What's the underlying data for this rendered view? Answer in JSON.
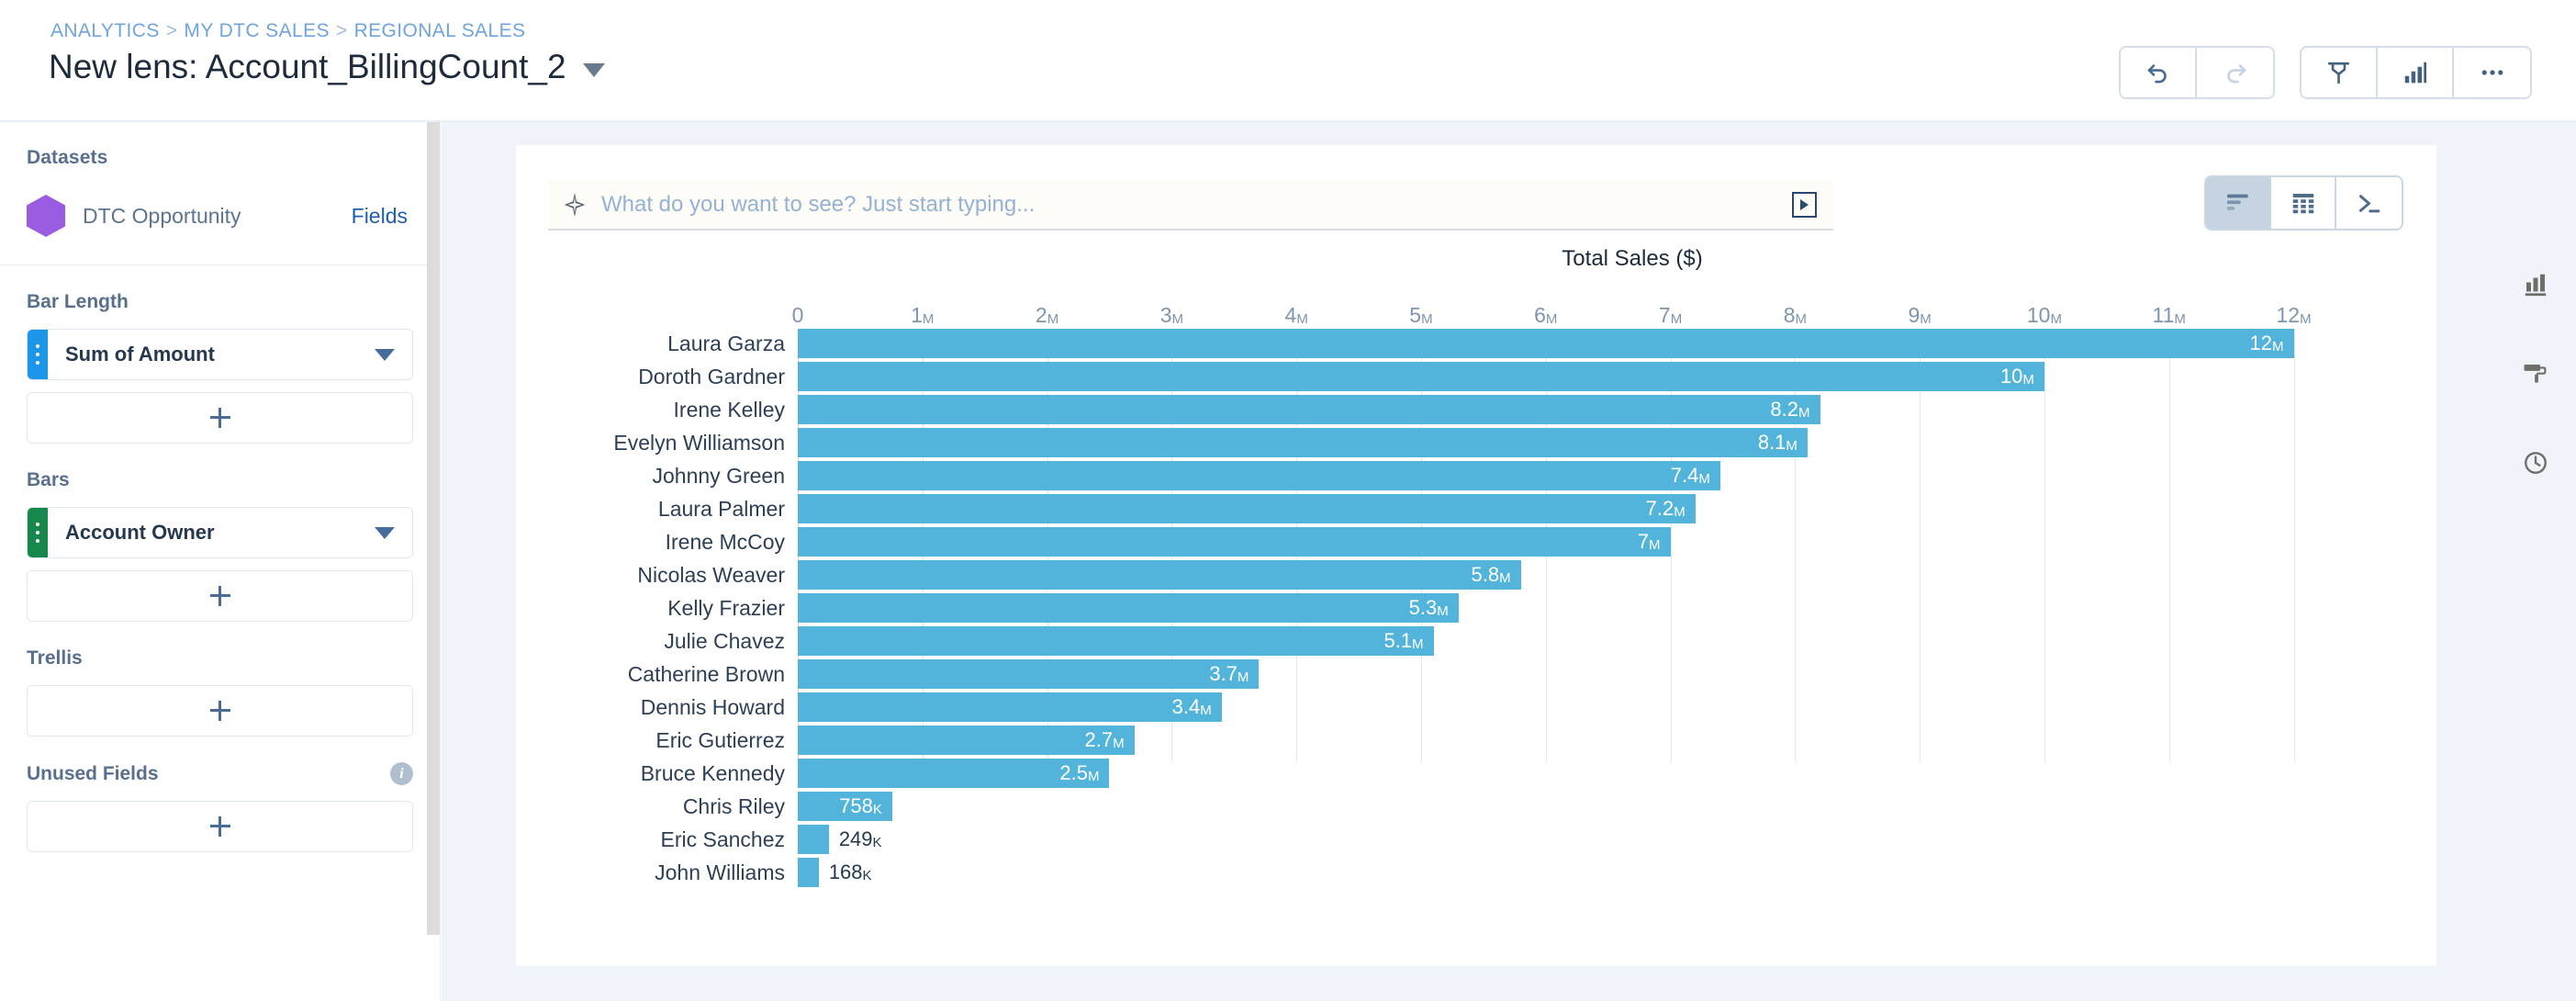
{
  "header": {
    "breadcrumb": [
      "ANALYTICS",
      "MY DTC SALES",
      "REGIONAL SALES"
    ],
    "breadcrumb_separator": ">",
    "title": "New lens: Account_BillingCount_2",
    "actions": [
      {
        "name": "undo-button",
        "icon": "undo-icon",
        "label": "Undo",
        "enabled": true
      },
      {
        "name": "redo-button",
        "icon": "redo-icon",
        "label": "Redo",
        "enabled": false
      },
      {
        "name": "clip-button",
        "icon": "clip-to-designer-icon",
        "label": "Clip to Designer"
      },
      {
        "name": "chart-button",
        "icon": "bar-chart-icon",
        "label": "Charts"
      },
      {
        "name": "more-button",
        "icon": "ellipsis-icon",
        "label": "More"
      }
    ]
  },
  "sidebar": {
    "datasets_label": "Datasets",
    "dataset_name": "DTC Opportunity",
    "fields_link": "Fields",
    "sections": [
      {
        "title": "Bar Length",
        "pill": "Sum of Amount",
        "pill_type": "measure"
      },
      {
        "title": "Bars",
        "pill": "Account Owner",
        "pill_type": "dimension"
      },
      {
        "title": "Trellis",
        "pill": null
      },
      {
        "title": "Unused Fields",
        "pill": null,
        "has_info": true
      }
    ],
    "add_label": "+"
  },
  "main": {
    "search": {
      "placeholder": "What do you want to see? Just start typing...",
      "value": "",
      "sparkle_icon": "sparkle-icon",
      "run_icon": "run-query-icon"
    },
    "view_toggle": [
      {
        "name": "chart-view",
        "icon": "bar-chart-view-icon",
        "active": true
      },
      {
        "name": "table-view",
        "icon": "table-grid-icon",
        "active": false
      },
      {
        "name": "query-view",
        "icon": "terminal-prompt-icon",
        "active": false
      }
    ]
  },
  "rail": [
    {
      "name": "chart-type-button",
      "icon": "bar-chart-icon"
    },
    {
      "name": "formatting-button",
      "icon": "paint-roller-icon"
    },
    {
      "name": "history-button",
      "icon": "clock-icon"
    }
  ],
  "chart_data": {
    "type": "bar",
    "orientation": "horizontal",
    "title": "",
    "xlabel": "Total Sales ($)",
    "ylabel": "",
    "xlim": [
      0,
      12600000
    ],
    "grid": true,
    "legend": false,
    "bar_color": "#53b4db",
    "tick_labels": [
      "0",
      "1M",
      "2M",
      "3M",
      "4M",
      "5M",
      "6M",
      "7M",
      "8M",
      "9M",
      "10M",
      "11M",
      "12M"
    ],
    "tick_values": [
      0,
      1000000,
      2000000,
      3000000,
      4000000,
      5000000,
      6000000,
      7000000,
      8000000,
      9000000,
      10000000,
      11000000,
      12000000
    ],
    "categories": [
      "Laura Garza",
      "Doroth Gardner",
      "Irene Kelley",
      "Evelyn Williamson",
      "Johnny Green",
      "Laura Palmer",
      "Irene McCoy",
      "Nicolas Weaver",
      "Kelly Frazier",
      "Julie Chavez",
      "Catherine Brown",
      "Dennis Howard",
      "Eric Gutierrez",
      "Bruce Kennedy",
      "Chris Riley",
      "Eric Sanchez",
      "John Williams"
    ],
    "values": [
      12000000,
      10000000,
      8200000,
      8100000,
      7400000,
      7200000,
      7000000,
      5800000,
      5300000,
      5100000,
      3700000,
      3400000,
      2700000,
      2500000,
      758000,
      249000,
      168000
    ],
    "value_labels": [
      "12M",
      "10M",
      "8.2M",
      "8.1M",
      "7.4M",
      "7.2M",
      "7M",
      "5.8M",
      "5.3M",
      "5.1M",
      "3.7M",
      "3.4M",
      "2.7M",
      "2.5M",
      "758K",
      "249K",
      "168K"
    ],
    "label_placement": [
      "inside",
      "inside",
      "inside",
      "inside",
      "inside",
      "inside",
      "inside",
      "inside",
      "inside",
      "inside",
      "inside",
      "inside",
      "inside",
      "inside",
      "inside",
      "outside",
      "outside"
    ]
  }
}
